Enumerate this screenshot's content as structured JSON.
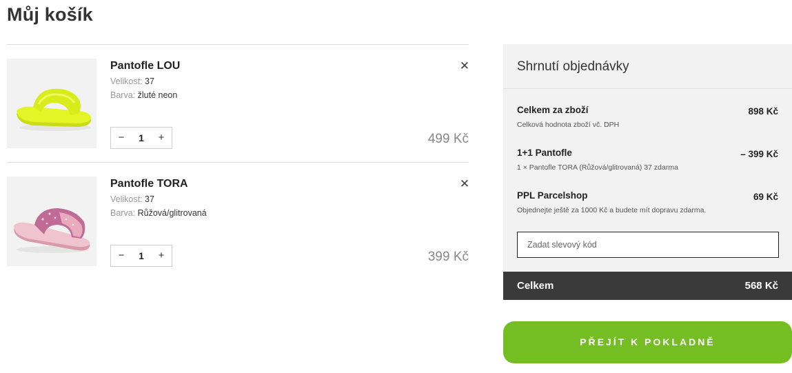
{
  "page": {
    "title": "Můj košík"
  },
  "cart": {
    "items": [
      {
        "name": "Pantofle LOU",
        "size_label": "Velikost:",
        "size": "37",
        "color_label": "Barva:",
        "color": "žluté neon",
        "quantity": "1",
        "price": "499 Kč",
        "minus": "−",
        "plus": "+",
        "remove": "✕",
        "image": "yellow-slide-sandal",
        "image_color": "#e3f527"
      },
      {
        "name": "Pantofle TORA",
        "size_label": "Velikost:",
        "size": "37",
        "color_label": "Barva:",
        "color": "Růžová/glitrovaná",
        "quantity": "1",
        "price": "399 Kč",
        "minus": "−",
        "plus": "+",
        "remove": "✕",
        "image": "pink-glitter-slide-sandal",
        "image_color": "#e8aabc"
      }
    ]
  },
  "summary": {
    "title": "Shrnutí objednávky",
    "rows": [
      {
        "title": "Celkem za zboží",
        "value": "898 Kč",
        "note": "Celková hodnota zboží vč. DPH"
      },
      {
        "title": "1+1 Pantofle",
        "value": "– 399 Kč",
        "note": "1 × Pantofle TORA (Růžová/glitrovaná) 37 zdarma"
      },
      {
        "title": "PPL Parcelshop",
        "value": "69 Kč",
        "note": "Objednejte ještě za 1000 Kč a budete mít dopravu zdarma."
      }
    ],
    "coupon_placeholder": "Zadat slevový kód",
    "total_label": "Celkem",
    "total_value": "568 Kč"
  },
  "checkout": {
    "label": "PŘEJÍT K POKLADNĚ",
    "color": "#74be24"
  },
  "colors": {
    "total_bar": "#3a3a3a",
    "summary_bg": "#f2f2f2"
  }
}
